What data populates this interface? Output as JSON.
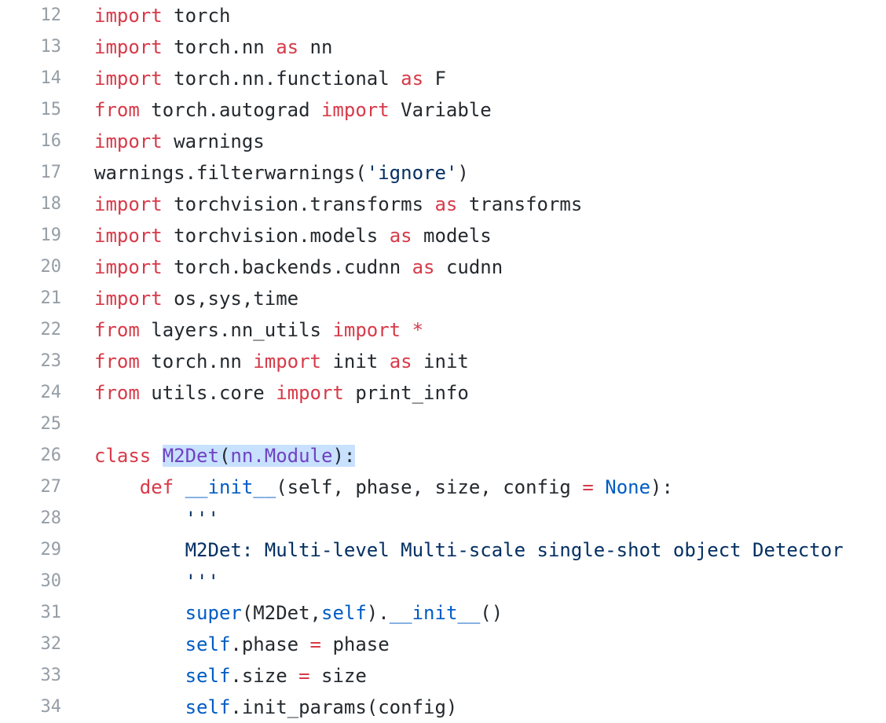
{
  "colors": {
    "keyword": "#d73a49",
    "string": "#032f62",
    "builtin": "#005cc5",
    "class_name": "#6f42c1",
    "plain": "#24292e",
    "line_number": "#959da5",
    "selection": "#c8e1ff"
  },
  "lines": [
    {
      "n": "12",
      "tokens": [
        [
          "import",
          "kw"
        ],
        [
          " torch",
          ""
        ]
      ]
    },
    {
      "n": "13",
      "tokens": [
        [
          "import",
          "kw"
        ],
        [
          " torch.nn ",
          ""
        ],
        [
          "as",
          "kw"
        ],
        [
          " nn",
          ""
        ]
      ]
    },
    {
      "n": "14",
      "tokens": [
        [
          "import",
          "kw"
        ],
        [
          " torch.nn.functional ",
          ""
        ],
        [
          "as",
          "kw"
        ],
        [
          " F",
          ""
        ]
      ]
    },
    {
      "n": "15",
      "tokens": [
        [
          "from",
          "kw"
        ],
        [
          " torch.autograd ",
          ""
        ],
        [
          "import",
          "kw"
        ],
        [
          " Variable",
          ""
        ]
      ]
    },
    {
      "n": "16",
      "tokens": [
        [
          "import",
          "kw"
        ],
        [
          " warnings",
          ""
        ]
      ]
    },
    {
      "n": "17",
      "tokens": [
        [
          "warnings.filterwarnings(",
          ""
        ],
        [
          "'ignore'",
          "str"
        ],
        [
          ")",
          ""
        ]
      ]
    },
    {
      "n": "18",
      "tokens": [
        [
          "import",
          "kw"
        ],
        [
          " torchvision.transforms ",
          ""
        ],
        [
          "as",
          "kw"
        ],
        [
          " transforms",
          ""
        ]
      ]
    },
    {
      "n": "19",
      "tokens": [
        [
          "import",
          "kw"
        ],
        [
          " torchvision.models ",
          ""
        ],
        [
          "as",
          "kw"
        ],
        [
          " models",
          ""
        ]
      ]
    },
    {
      "n": "20",
      "tokens": [
        [
          "import",
          "kw"
        ],
        [
          " torch.backends.cudnn ",
          ""
        ],
        [
          "as",
          "kw"
        ],
        [
          " cudnn",
          ""
        ]
      ]
    },
    {
      "n": "21",
      "tokens": [
        [
          "import",
          "kw"
        ],
        [
          " os,sys,time",
          ""
        ]
      ]
    },
    {
      "n": "22",
      "tokens": [
        [
          "from",
          "kw"
        ],
        [
          " layers.nn_utils ",
          ""
        ],
        [
          "import",
          "kw"
        ],
        [
          " ",
          ""
        ],
        [
          "*",
          "kw"
        ]
      ]
    },
    {
      "n": "23",
      "tokens": [
        [
          "from",
          "kw"
        ],
        [
          " torch.nn ",
          ""
        ],
        [
          "import",
          "kw"
        ],
        [
          " init ",
          ""
        ],
        [
          "as",
          "kw"
        ],
        [
          " init",
          ""
        ]
      ]
    },
    {
      "n": "24",
      "tokens": [
        [
          "from",
          "kw"
        ],
        [
          " utils.core ",
          ""
        ],
        [
          "import",
          "kw"
        ],
        [
          " print_info",
          ""
        ]
      ]
    },
    {
      "n": "25",
      "tokens": []
    },
    {
      "n": "26",
      "tokens": [
        [
          "class",
          "kw"
        ],
        [
          " ",
          ""
        ],
        [
          "M2Det",
          "cls hl"
        ],
        [
          "(",
          "hl"
        ],
        [
          "nn.Module",
          "cls hl"
        ],
        [
          "):",
          "hl"
        ]
      ]
    },
    {
      "n": "27",
      "tokens": [
        [
          "    ",
          ""
        ],
        [
          "def",
          "kw"
        ],
        [
          " ",
          ""
        ],
        [
          "__init__",
          "builtin"
        ],
        [
          "(self, phase, size, config ",
          ""
        ],
        [
          "=",
          "kw"
        ],
        [
          " ",
          ""
        ],
        [
          "None",
          "builtin"
        ],
        [
          "):",
          ""
        ]
      ]
    },
    {
      "n": "28",
      "tokens": [
        [
          "        ",
          ""
        ],
        [
          "'''",
          "str"
        ]
      ]
    },
    {
      "n": "29",
      "tokens": [
        [
          "        ",
          ""
        ],
        [
          "M2Det: Multi-level Multi-scale single-shot object Detector",
          "str"
        ]
      ]
    },
    {
      "n": "30",
      "tokens": [
        [
          "        ",
          ""
        ],
        [
          "'''",
          "str"
        ]
      ]
    },
    {
      "n": "31",
      "tokens": [
        [
          "        ",
          ""
        ],
        [
          "super",
          "builtin"
        ],
        [
          "(M2Det,",
          ""
        ],
        [
          "self",
          "builtin"
        ],
        [
          ").",
          ""
        ],
        [
          "__init__",
          "builtin"
        ],
        [
          "()",
          ""
        ]
      ]
    },
    {
      "n": "32",
      "tokens": [
        [
          "        ",
          ""
        ],
        [
          "self",
          "builtin"
        ],
        [
          ".phase ",
          ""
        ],
        [
          "=",
          "kw"
        ],
        [
          " phase",
          ""
        ]
      ]
    },
    {
      "n": "33",
      "tokens": [
        [
          "        ",
          ""
        ],
        [
          "self",
          "builtin"
        ],
        [
          ".size ",
          ""
        ],
        [
          "=",
          "kw"
        ],
        [
          " size",
          ""
        ]
      ]
    },
    {
      "n": "34",
      "tokens": [
        [
          "        ",
          ""
        ],
        [
          "self",
          "builtin"
        ],
        [
          ".init_params(config)",
          ""
        ]
      ]
    }
  ]
}
